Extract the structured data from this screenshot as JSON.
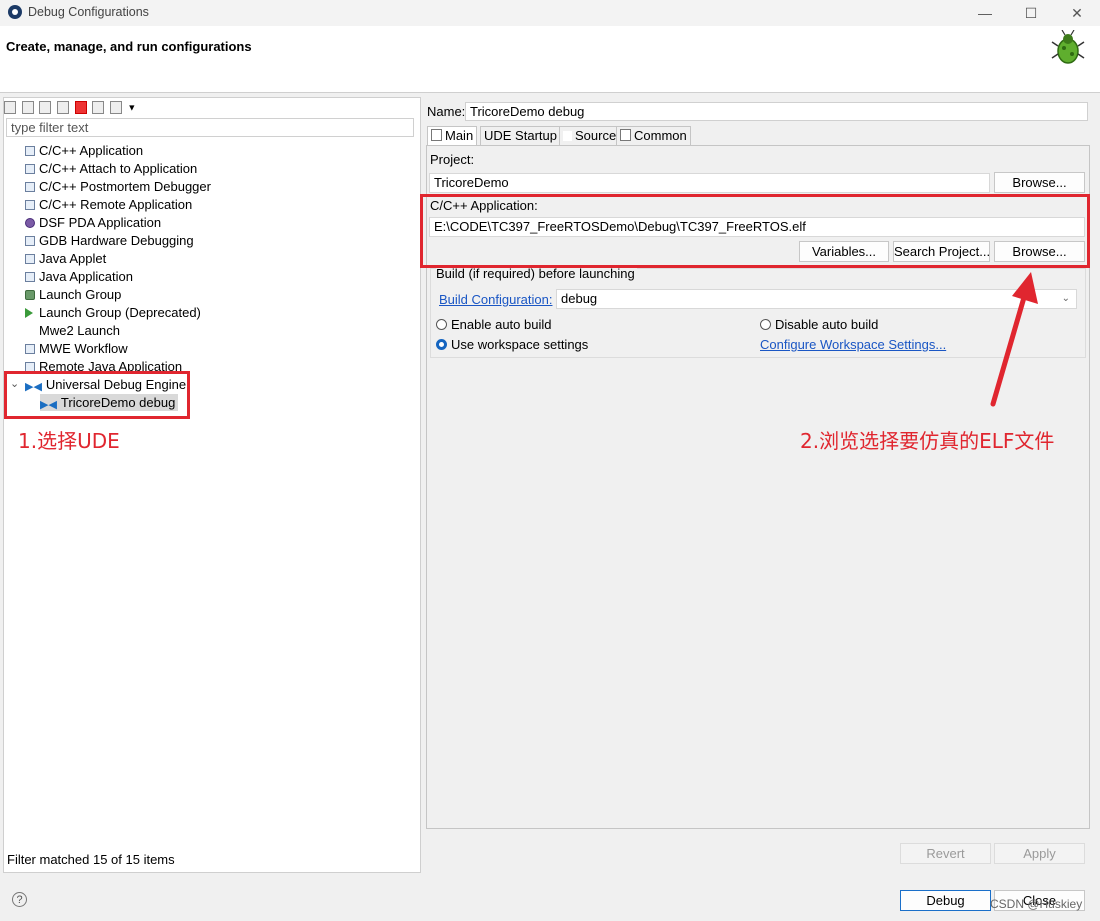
{
  "window": {
    "title": "Debug Configurations"
  },
  "header": {
    "title": "Create, manage, and run configurations"
  },
  "filter": {
    "placeholder": "type filter text"
  },
  "tree": {
    "items": [
      {
        "label": "C/C++ Application",
        "icon": "c-icon"
      },
      {
        "label": "C/C++ Attach to Application",
        "icon": "c-icon"
      },
      {
        "label": "C/C++ Postmortem Debugger",
        "icon": "c-icon"
      },
      {
        "label": "C/C++ Remote Application",
        "icon": "c-icon"
      },
      {
        "label": "DSF PDA Application",
        "icon": "dsf-icon"
      },
      {
        "label": "GDB Hardware Debugging",
        "icon": "c-icon"
      },
      {
        "label": "Java Applet",
        "icon": "java-icon"
      },
      {
        "label": "Java Application",
        "icon": "java-icon"
      },
      {
        "label": "Launch Group",
        "icon": "launch-icon"
      },
      {
        "label": "Launch Group (Deprecated)",
        "icon": "play-icon"
      },
      {
        "label": "Mwe2 Launch",
        "icon": "none"
      },
      {
        "label": "MWE Workflow",
        "icon": "mwe-icon"
      },
      {
        "label": "Remote Java Application",
        "icon": "remote-icon"
      },
      {
        "label": "Universal Debug Engine",
        "icon": "ude-icon"
      }
    ],
    "child": {
      "label": "TricoreDemo debug",
      "icon": "ude-icon"
    },
    "status": "Filter matched 15 of 15 items"
  },
  "config": {
    "name_label": "Name:",
    "name_value": "TricoreDemo debug",
    "tabs": [
      {
        "label": "Main"
      },
      {
        "label": "UDE Startup"
      },
      {
        "label": "Source"
      },
      {
        "label": "Common"
      }
    ],
    "project_label": "Project:",
    "project_value": "TricoreDemo",
    "project_browse": "Browse...",
    "app_label": "C/C++ Application:",
    "app_value": "E:\\CODE\\TC397_FreeRTOSDemo\\Debug\\TC397_FreeRTOS.elf",
    "variables_btn": "Variables...",
    "search_btn": "Search Project...",
    "app_browse": "Browse...",
    "build_group_label": "Build (if required) before launching",
    "build_config_link": "Build Configuration:",
    "build_config_value": "debug",
    "radio_enable": "Enable auto build",
    "radio_disable": "Disable auto build",
    "radio_workspace": "Use workspace settings",
    "configure_link": "Configure Workspace Settings..."
  },
  "actions": {
    "revert": "Revert",
    "apply": "Apply",
    "debug": "Debug",
    "close": "Close"
  },
  "annotations": {
    "step1": "1.选择UDE",
    "step2": "2.浏览选择要仿真的ELF文件",
    "color": "#e0262f"
  },
  "watermark": "CSDN @Huskiey"
}
